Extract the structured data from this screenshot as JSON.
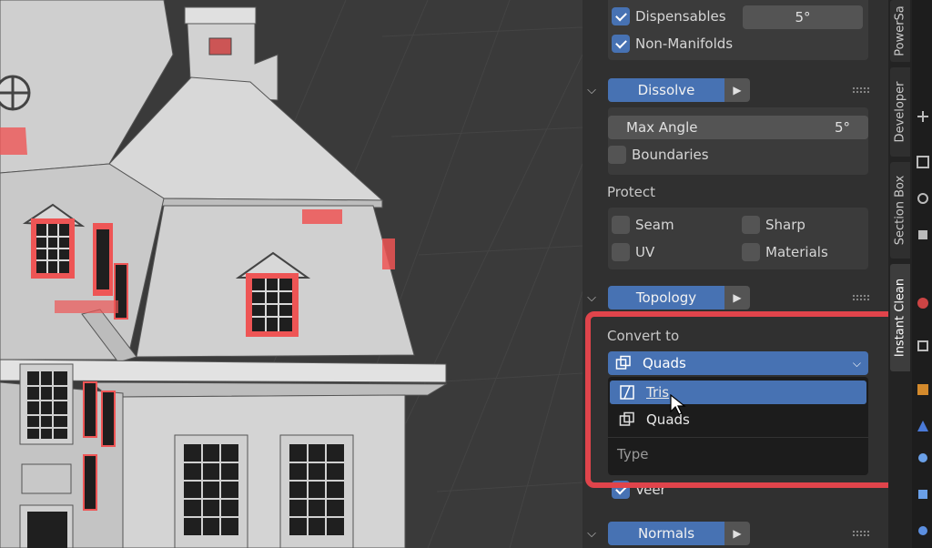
{
  "panel": {
    "top": {
      "dispensables_label": "Dispensables",
      "dispensables_value": "5°",
      "non_manifolds_label": "Non-Manifolds"
    },
    "dissolve": {
      "button": "Dissolve",
      "max_angle_label": "Max Angle",
      "max_angle_value": "5°",
      "boundaries_label": "Boundaries"
    },
    "protect": {
      "heading": "Protect",
      "seam": "Seam",
      "sharp": "Sharp",
      "uv": "UV",
      "materials": "Materials"
    },
    "topology": {
      "button": "Topology",
      "convert_to_label": "Convert to",
      "selected": "Quads",
      "options": [
        "Tris",
        "Quads"
      ],
      "menu_footer": "Type",
      "hidden_row_partial": "Veer"
    },
    "normals": {
      "button": "Normals"
    }
  },
  "tabs": [
    "PowerSa",
    "Developer",
    "Section Box",
    "Instant Clean"
  ],
  "colors": {
    "accent": "#4772b3",
    "highlight": "#e0444b",
    "panel": "#303030"
  }
}
